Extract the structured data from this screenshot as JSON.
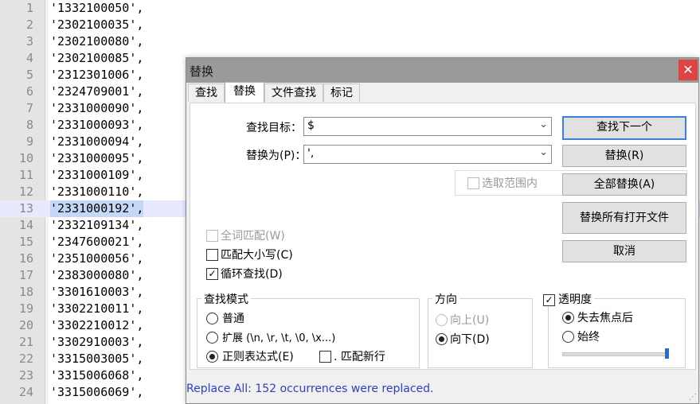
{
  "editor": {
    "lines": [
      {
        "num": "1",
        "text": "'1332100050',"
      },
      {
        "num": "2",
        "text": "'2302100035',"
      },
      {
        "num": "3",
        "text": "'2302100080',"
      },
      {
        "num": "4",
        "text": "'2302100085',"
      },
      {
        "num": "5",
        "text": "'2312301006',"
      },
      {
        "num": "6",
        "text": "'2324709001',"
      },
      {
        "num": "7",
        "text": "'2331000090',"
      },
      {
        "num": "8",
        "text": "'2331000093',"
      },
      {
        "num": "9",
        "text": "'2331000094',"
      },
      {
        "num": "10",
        "text": "'2331000095',"
      },
      {
        "num": "11",
        "text": "'2331000109',"
      },
      {
        "num": "12",
        "text": "'2331000110',"
      },
      {
        "num": "13",
        "text": "'2331000192',"
      },
      {
        "num": "14",
        "text": "'2332109134',"
      },
      {
        "num": "15",
        "text": "'2347600021',"
      },
      {
        "num": "16",
        "text": "'2351000056',"
      },
      {
        "num": "17",
        "text": "'2383000080',"
      },
      {
        "num": "18",
        "text": "'3301610003',"
      },
      {
        "num": "19",
        "text": "'3302210011',"
      },
      {
        "num": "20",
        "text": "'3302210012',"
      },
      {
        "num": "21",
        "text": "'3302910003',"
      },
      {
        "num": "22",
        "text": "'3315003005',"
      },
      {
        "num": "23",
        "text": "'3315006068',"
      },
      {
        "num": "24",
        "text": "'3315006069',"
      }
    ],
    "current_line": "13"
  },
  "dialog": {
    "title": "替换",
    "close_glyph": "✕",
    "tabs": [
      {
        "label": "查找"
      },
      {
        "label": "替换",
        "active": true
      },
      {
        "label": "文件查找"
      },
      {
        "label": "标记"
      }
    ],
    "find_label": "查找目标：",
    "find_value": "$",
    "replace_label": "替换为(P)：",
    "replace_value": "',",
    "in_selection": "选取范围内",
    "buttons": {
      "find_next": "查找下一个",
      "replace": "替换(R)",
      "replace_all": "全部替换(A)",
      "replace_all_open": "替换所有打开文件",
      "cancel": "取消"
    },
    "options": {
      "whole_word": {
        "label": "全词匹配(W)",
        "checked": false,
        "disabled": true
      },
      "match_case": {
        "label": "匹配大小写(C)",
        "checked": false
      },
      "wrap_around": {
        "label": "循环查找(D)",
        "checked": true
      }
    },
    "search_mode": {
      "title": "查找模式",
      "normal": "普通",
      "extended": "扩展 (\\n, \\r, \\t, \\0, \\x...)",
      "regex": "正则表达式(E)",
      "dot_newline": ". 匹配新行",
      "selected": "regex"
    },
    "direction": {
      "title": "方向",
      "up": "向上(U)",
      "down": "向下(D)",
      "selected": "down"
    },
    "transparency": {
      "title": "透明度",
      "checked": true,
      "on_lose_focus": "失去焦点后",
      "always": "始终",
      "selected": "on_lose_focus",
      "level": 1.0
    },
    "status": "Replace All: 152 occurrences were replaced.",
    "check_glyph": "✓"
  },
  "colors": {
    "status_text": "#2f3fbf",
    "close_button": "#e04343",
    "slider_thumb": "#1e6fd8",
    "default_button_border": "#3c7fd8"
  }
}
